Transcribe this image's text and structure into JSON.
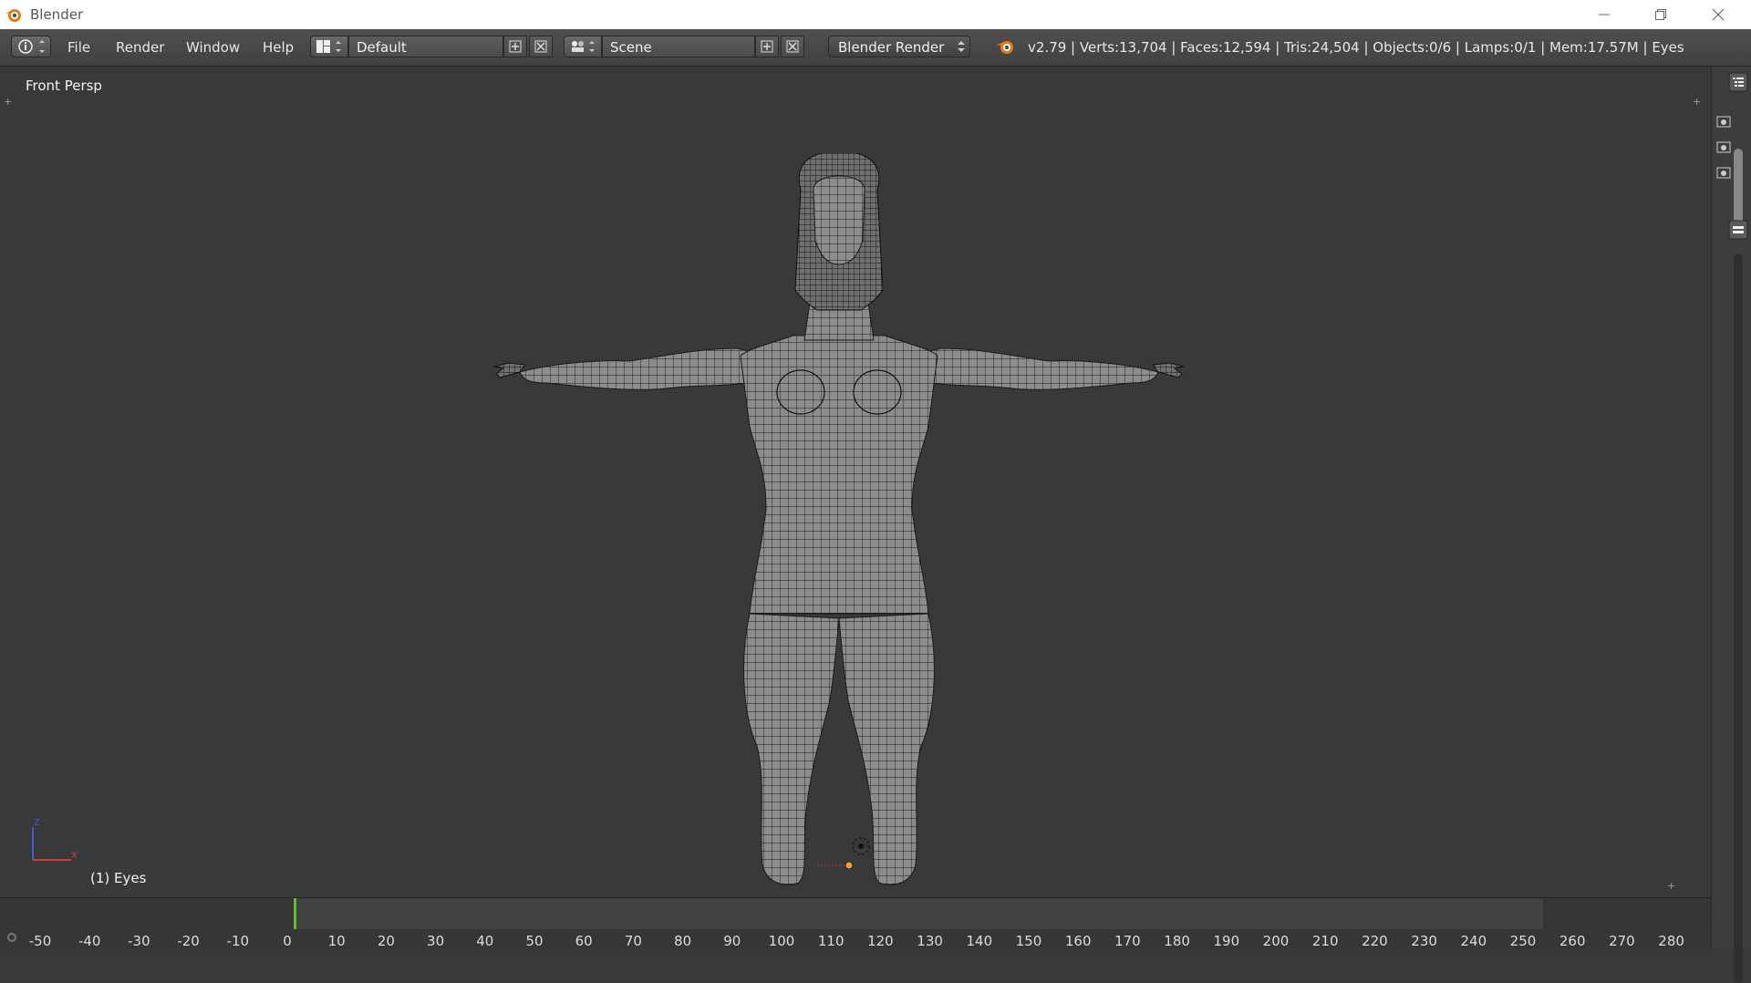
{
  "window": {
    "title": "Blender"
  },
  "menubar": {
    "menus": [
      "File",
      "Render",
      "Window",
      "Help"
    ],
    "screen_layout": "Default",
    "scene": "Scene",
    "render_engine": "Blender Render",
    "stats": "v2.79 | Verts:13,704 | Faces:12,594 | Tris:24,504 | Objects:0/6 | Lamps:0/1 | Mem:17.57M | Eyes"
  },
  "viewport": {
    "view_name": "Front Persp",
    "active_object": "(1) Eyes",
    "axis_labels": {
      "z": "Z",
      "x": "X"
    }
  },
  "timeline": {
    "current_frame": 0,
    "ticks": [
      "-50",
      "-40",
      "-30",
      "-20",
      "-10",
      "0",
      "10",
      "20",
      "30",
      "40",
      "50",
      "60",
      "70",
      "80",
      "90",
      "100",
      "110",
      "120",
      "130",
      "140",
      "150",
      "160",
      "170",
      "180",
      "190",
      "200",
      "210",
      "220",
      "230",
      "240",
      "250",
      "260",
      "270",
      "280"
    ]
  },
  "colors": {
    "viewport_bg": "#393939",
    "header_bg": "#4a4a4a",
    "frame_cursor": "#58c230",
    "blender_orange": "#e87d0d"
  },
  "icons": [
    "blender-logo-icon",
    "minimize-icon",
    "restore-icon",
    "close-icon",
    "info-editor-icon",
    "screen-layout-icon",
    "scene-icon",
    "add-icon",
    "delete-icon",
    "outliner-icon",
    "properties-icon"
  ]
}
